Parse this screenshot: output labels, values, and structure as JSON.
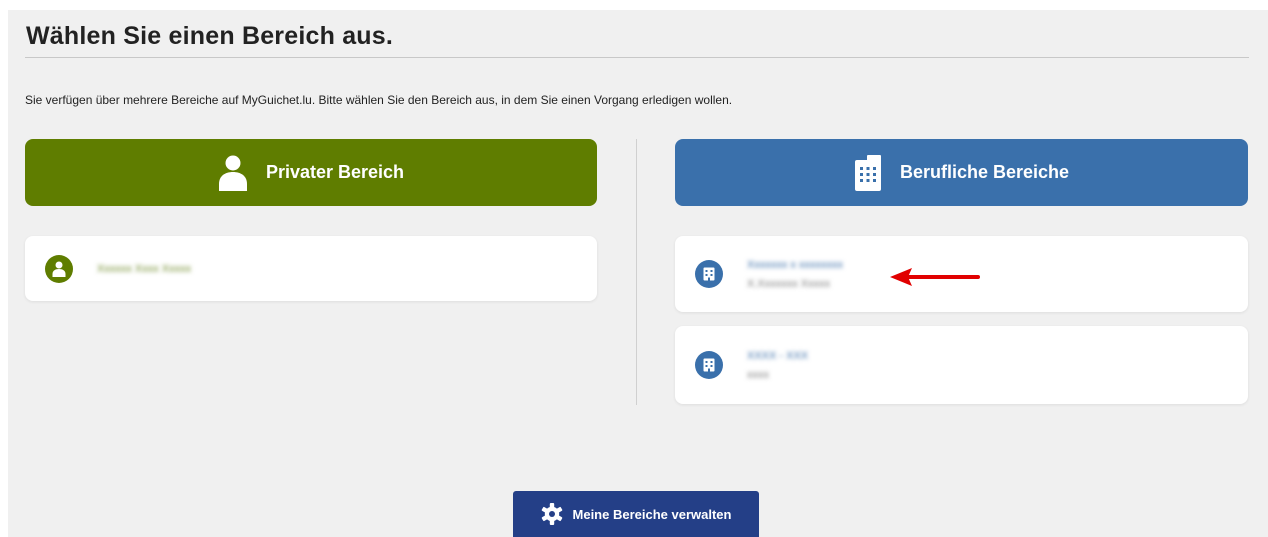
{
  "page": {
    "title": "Wählen Sie einen Bereich aus.",
    "intro": "Sie verfügen über mehrere Bereiche auf MyGuichet.lu. Bitte wählen Sie den Bereich aus, in dem Sie einen Vorgang erledigen wollen."
  },
  "private_section": {
    "label": "Privater Bereich",
    "icon": "person-icon",
    "color": "#5f7d00",
    "cards": [
      {
        "line1": "Xxxxxx Xxxx Xxxxx",
        "icon": "user-circle-icon"
      }
    ]
  },
  "business_section": {
    "label": "Berufliche Bereiche",
    "icon": "building-icon",
    "color": "#3a70ab",
    "cards": [
      {
        "line1": "Xxxxxxx x xxxxxxxx",
        "line2": "X.Xxxxxxx Xxxxx",
        "icon": "building-icon"
      },
      {
        "line1": "XXXX - XXX",
        "line2": "xxxx",
        "icon": "building-icon"
      }
    ]
  },
  "annotation": {
    "icon": "red-arrow-icon",
    "color": "#e10000"
  },
  "footer": {
    "manage_label": "Meine Bereiche verwalten",
    "icon": "gear-icon",
    "color": "#243f87"
  }
}
